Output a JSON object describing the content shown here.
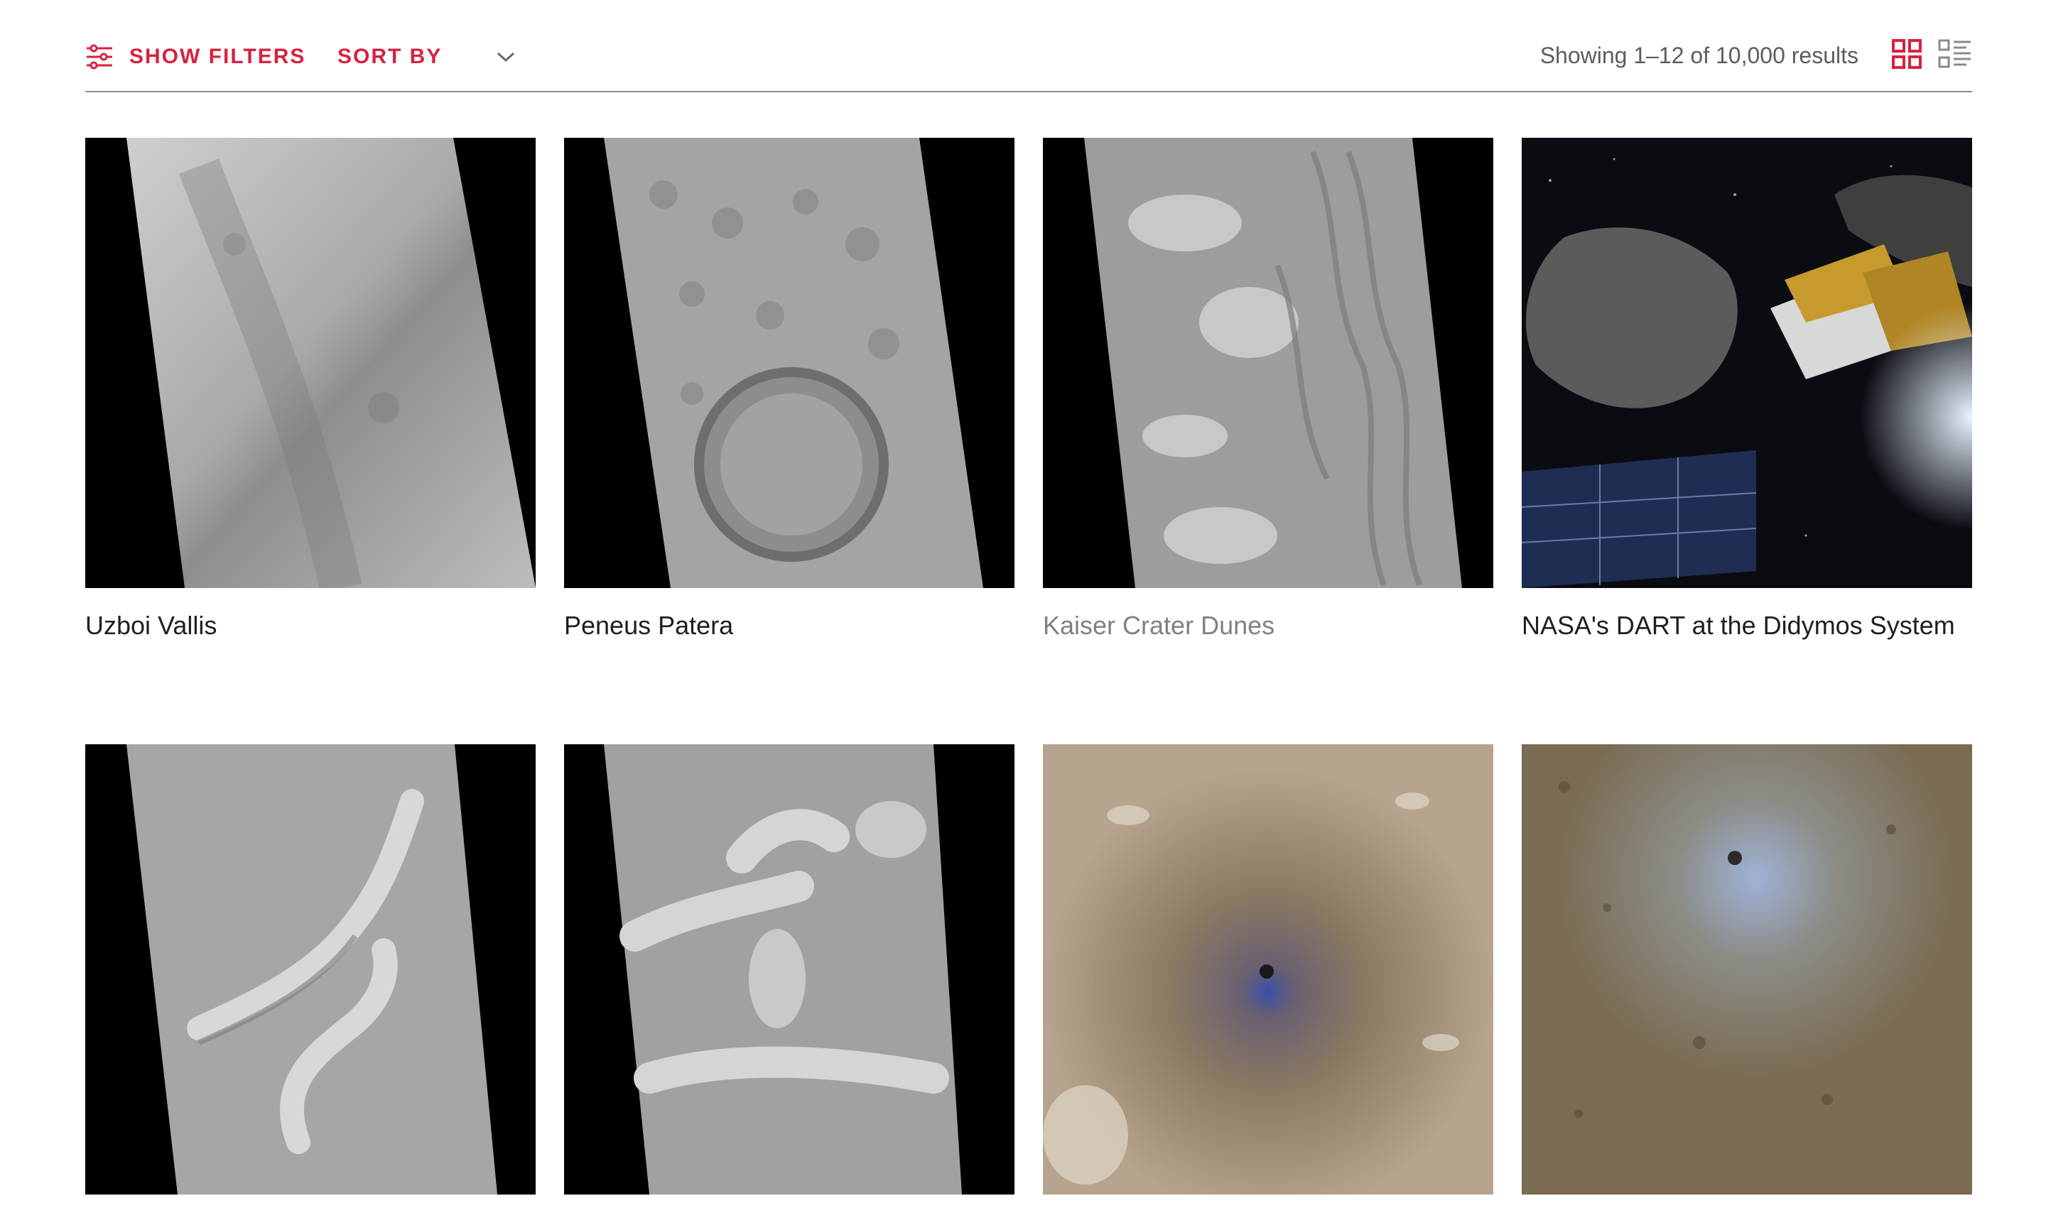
{
  "toolbar": {
    "show_filters_label": "SHOW FILTERS",
    "sort_by_label": "SORT BY",
    "results_text": "Showing 1–12 of 10,000 results",
    "accent_color": "#d6223f",
    "icons": {
      "filters": "sliders-icon",
      "sort": "chevron-down-icon",
      "grid_view": "grid-view-icon",
      "list_view": "list-view-icon"
    }
  },
  "cards": [
    {
      "title": "Uzboi Vallis"
    },
    {
      "title": "Peneus Patera"
    },
    {
      "title": "Kaiser Crater Dunes"
    },
    {
      "title": "NASA's DART at the Didymos System"
    },
    {
      "title": ""
    },
    {
      "title": ""
    },
    {
      "title": ""
    },
    {
      "title": ""
    }
  ]
}
